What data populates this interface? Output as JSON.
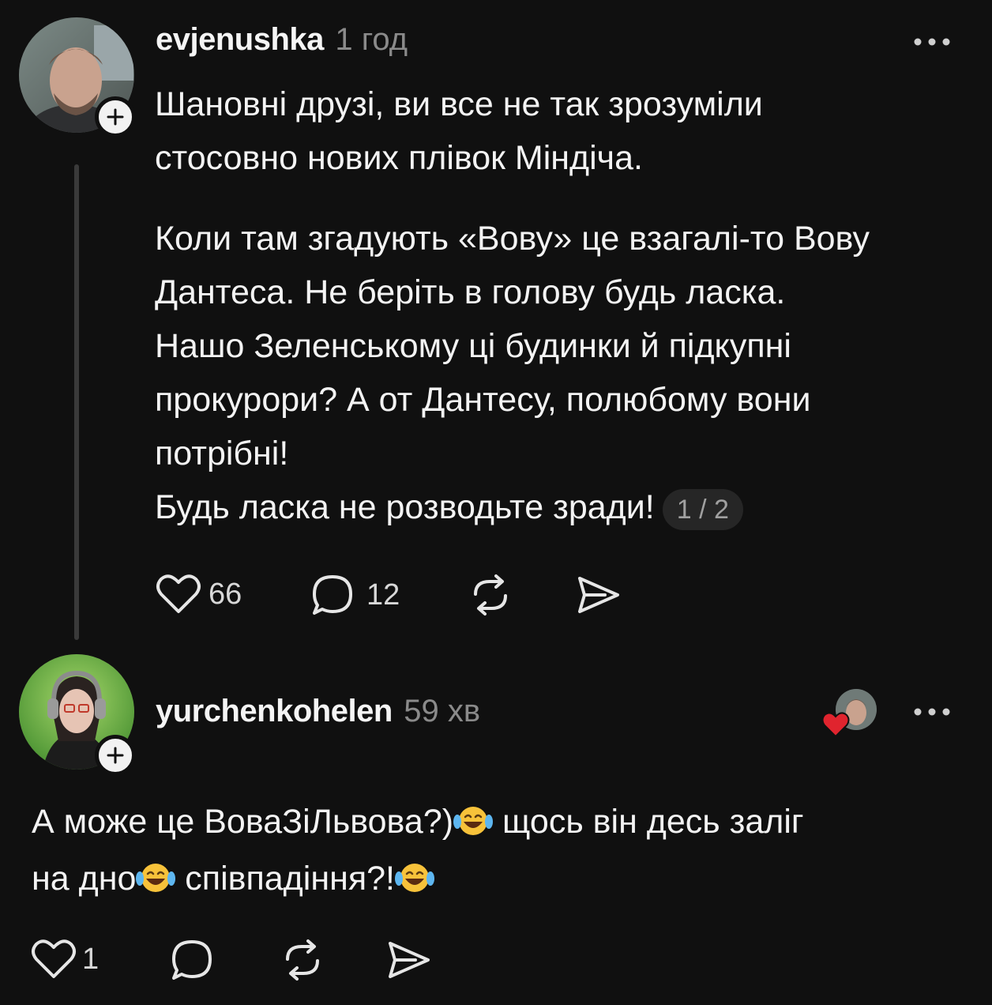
{
  "post1": {
    "username": "evjenushka",
    "time": "1 год",
    "paragraph1_lines": [
      "Шановні друзі, ви все не так зрозуміли",
      "стосовно нових плівок Міндіча."
    ],
    "paragraph2_lines": [
      "Коли там згадують «Вову» це взагалі-то Вову",
      "Дантеса. Не беріть в голову будь ласка.",
      "Нашо Зеленському ці будинки й підкупні",
      "прокурори? А от Дантесу, полюбому вони",
      "потрібні!"
    ],
    "last_line": "Будь ласка не розводьте зради!",
    "pager": "1 / 2",
    "likes": "66",
    "replies": "12"
  },
  "post2": {
    "username": "yurchenkohelen",
    "time": "59 хв",
    "line1_a": "А може це ВоваЗіЛьвова?)",
    "line1_b": " щось він десь заліг",
    "line2_a": "на дно",
    "line2_b": " співпадіння?!",
    "likes": "1"
  },
  "icons": {
    "more": "more-horizontal-icon",
    "like": "heart-outline-icon",
    "reply": "speech-bubble-icon",
    "repost": "repost-arrows-icon",
    "share": "send-icon",
    "follow": "plus-icon",
    "liked_by_author": "red-heart-icon",
    "emoji": "face-with-tears-of-joy-emoji"
  },
  "colors": {
    "background": "#101010",
    "text": "#f3f3f3",
    "muted": "#8a8a8a",
    "heart_red": "#e0242e"
  }
}
